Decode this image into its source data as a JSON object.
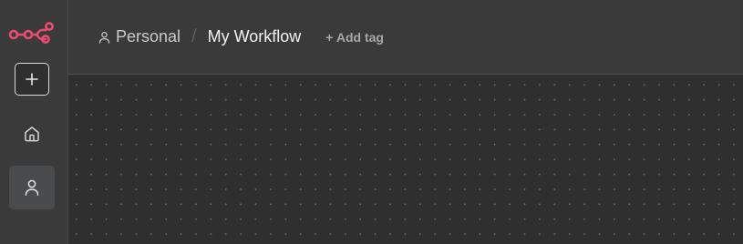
{
  "colors": {
    "brand": "#ea4b71",
    "sidebar_bg": "#3a3a3a",
    "header_bg": "#3a3a3a",
    "canvas_bg": "#2e2f2e",
    "active_nav_bg": "#4a4b4d"
  },
  "sidebar": {
    "logo_icon": "n8n-logo-icon",
    "new_button_icon": "plus-icon",
    "items": [
      {
        "icon": "home-icon",
        "active": false
      },
      {
        "icon": "user-icon",
        "active": true
      }
    ]
  },
  "header": {
    "breadcrumb": {
      "project_icon": "user-icon",
      "project": "Personal",
      "separator": "/",
      "workflow": "My Workflow"
    },
    "add_tag": "+ Add tag"
  }
}
